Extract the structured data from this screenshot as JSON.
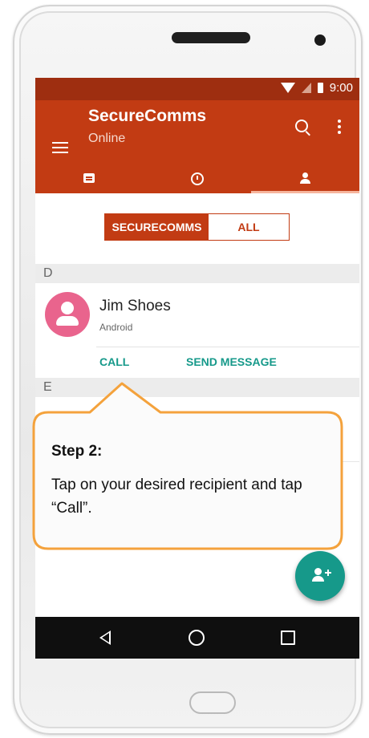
{
  "status_bar": {
    "time": "9:00"
  },
  "app_bar": {
    "title": "SecureComms",
    "subtitle": "Online",
    "tabs": [
      "messages",
      "recent",
      "contacts"
    ],
    "active_tab": "contacts"
  },
  "filter_toggle": {
    "option_1": "SECURECOMMS",
    "option_2": "ALL",
    "selected": "SECURECOMMS"
  },
  "sections": [
    {
      "letter": "D"
    },
    {
      "letter": "E"
    }
  ],
  "contact": {
    "name": "Jim Shoes",
    "platform": "Android",
    "call_label": "CALL",
    "message_label": "SEND MESSAGE"
  },
  "callout": {
    "title": "Step 2:",
    "body": "Tap on your desired recipient and tap “Call”."
  },
  "colors": {
    "status_bar": "#9e2e10",
    "app_bar": "#c23b13",
    "accent_teal": "#16998a",
    "avatar_pink": "#e9648d",
    "callout_border": "#f4a23c",
    "callout_fill": "#fbfbfb"
  },
  "icons": [
    "menu-icon",
    "search-icon",
    "more-vert-icon",
    "chat-icon",
    "clock-icon",
    "contacts-icon",
    "add-contact-icon",
    "back-icon",
    "home-icon",
    "recents-icon"
  ]
}
